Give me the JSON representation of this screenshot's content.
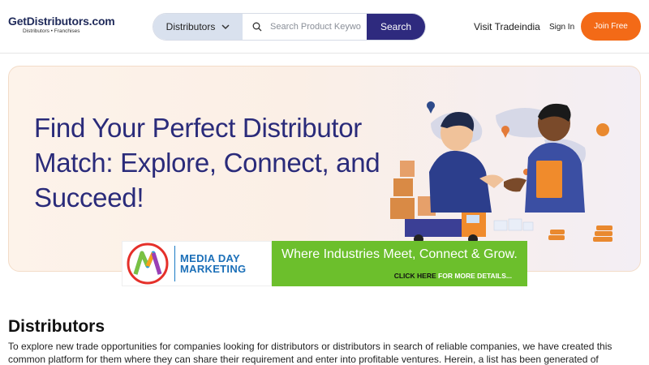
{
  "header": {
    "logo_text": "GetDistributors.com",
    "logo_tagline": "Distributors  •  Franchises",
    "search": {
      "category": "Distributors",
      "placeholder": "Search Product Keyword",
      "button_label": "Search"
    },
    "links": {
      "visit": "Visit Tradeindia",
      "signin": "Sign In"
    },
    "join_label": "Join Free",
    "accent_color": "#f36a17",
    "primary_color": "#2e2a7e"
  },
  "hero": {
    "title": "Find Your Perfect Distributor Match: Explore, Connect, and Succeed!",
    "title_color": "#2a2b7a"
  },
  "ad": {
    "brand_line1": "MEDIA DAY",
    "brand_line2": "MARKETING",
    "tagline": "Where Industries Meet, Connect & Grow.",
    "cta_bold": "CLICK HERE",
    "cta_rest": " FOR MORE DETAILS...",
    "green": "#6cbf2c"
  },
  "content": {
    "heading": "Distributors",
    "paragraph": "To explore new trade opportunities for companies looking for distributors or distributors in search of reliable companies, we have created this common platform for them where they can share their requirement and enter into profitable ventures. Herein, a list has been generated of prominent distributors"
  }
}
